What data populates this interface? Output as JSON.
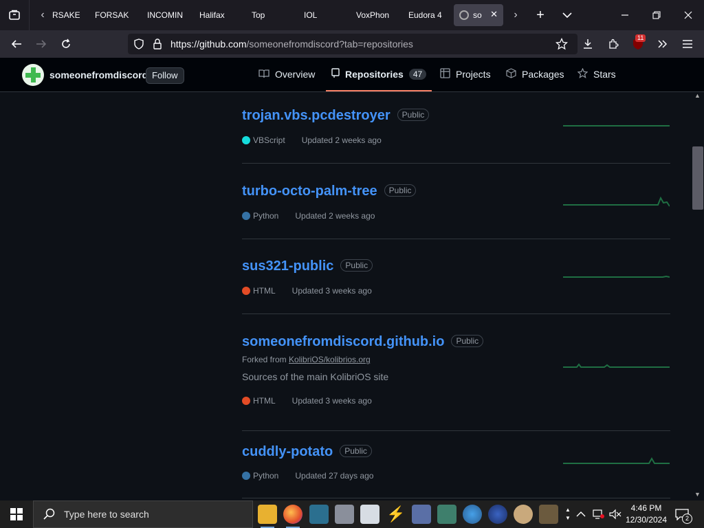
{
  "browser": {
    "tabs": [
      {
        "label": "RSAKE",
        "active": false
      },
      {
        "label": "FORSAKE",
        "active": false
      },
      {
        "label": "INCOMIN",
        "active": false
      },
      {
        "label": "Halifax",
        "active": false
      },
      {
        "label": "Top",
        "active": false
      },
      {
        "label": "IOL",
        "active": false
      },
      {
        "label": "VoxPhon",
        "active": false
      },
      {
        "label": "Eudora 4",
        "active": false
      },
      {
        "label": "so",
        "active": true
      }
    ],
    "url_host": "https://github.com",
    "url_path": "/someonefromdiscord?tab=repositories",
    "extension_badge": "11"
  },
  "profile": {
    "username": "someonefromdiscord",
    "follow_label": "Follow"
  },
  "nav": {
    "overview": "Overview",
    "repositories": "Repositories",
    "repositories_count": "47",
    "projects": "Projects",
    "packages": "Packages",
    "stars": "Stars"
  },
  "repos": [
    {
      "name": "trojan.vbs.pcdestroyer",
      "visibility": "Public",
      "language": "VBScript",
      "lang_color": "#15dcdc",
      "updated": "Updated 2 weeks ago"
    },
    {
      "name": "turbo-octo-palm-tree",
      "visibility": "Public",
      "language": "Python",
      "lang_color": "#3572A5",
      "updated": "Updated 2 weeks ago"
    },
    {
      "name": "sus321-public",
      "visibility": "Public",
      "language": "HTML",
      "lang_color": "#e34c26",
      "updated": "Updated 3 weeks ago"
    },
    {
      "name": "someonefromdiscord.github.io",
      "visibility": "Public",
      "forked_prefix": "Forked from ",
      "forked_from": "KolibriOS/kolibrios.org",
      "description": "Sources of the main KolibriOS site",
      "language": "HTML",
      "lang_color": "#e34c26",
      "updated": "Updated 3 weeks ago"
    },
    {
      "name": "cuddly-potato",
      "visibility": "Public",
      "language": "Python",
      "lang_color": "#3572A5",
      "updated": "Updated 27 days ago"
    }
  ],
  "taskbar": {
    "search_placeholder": "Type here to search",
    "time": "4:46 PM",
    "date": "12/30/2024",
    "notification_count": "2"
  },
  "colors": {
    "link": "#4493f8",
    "selected_underline": "#f78166",
    "sparkline": "#1f6f43"
  }
}
